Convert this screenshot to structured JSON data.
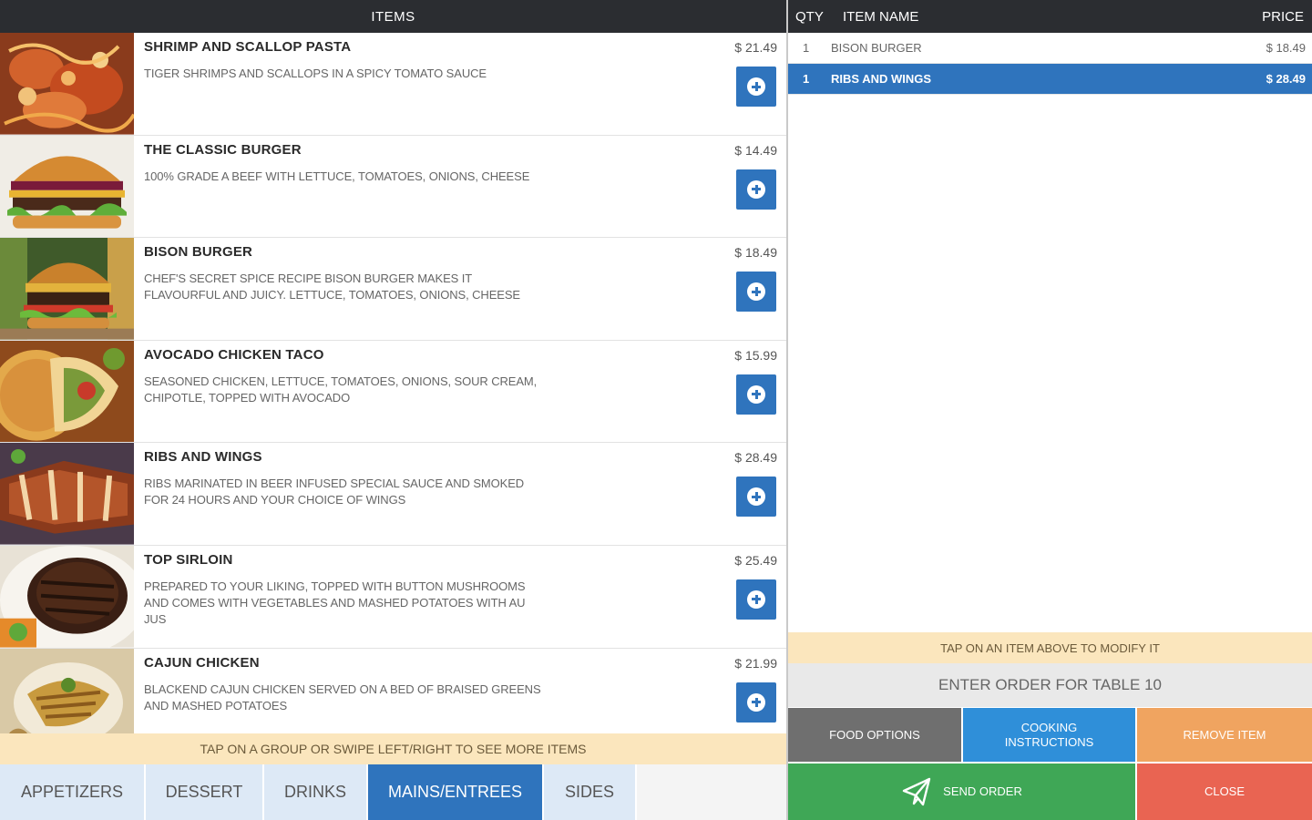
{
  "left_header": {
    "title": "ITEMS"
  },
  "menu_items": [
    {
      "name": "SHRIMP AND SCALLOP PASTA",
      "description": "TIGER SHRIMPS AND SCALLOPS IN A SPICY TOMATO SAUCE",
      "price": "$ 21.49",
      "image": "pasta"
    },
    {
      "name": "THE CLASSIC BURGER",
      "description": "100% GRADE A BEEF WITH LETTUCE, TOMATOES, ONIONS, CHEESE",
      "price": "$ 14.49",
      "image": "burger"
    },
    {
      "name": "BISON BURGER",
      "description": "CHEF'S SECRET SPICE RECIPE BISON BURGER MAKES IT FLAVOURFUL AND JUICY. LETTUCE, TOMATOES, ONIONS, CHEESE",
      "price": "$ 18.49",
      "image": "bison-burger"
    },
    {
      "name": "AVOCADO CHICKEN TACO",
      "description": "SEASONED CHICKEN, LETTUCE, TOMATOES, ONIONS, SOUR CREAM, CHIPOTLE, TOPPED WITH AVOCADO",
      "price": "$ 15.99",
      "image": "taco"
    },
    {
      "name": "RIBS AND WINGS",
      "description": "RIBS MARINATED IN BEER INFUSED SPECIAL SAUCE AND SMOKED FOR 24 HOURS AND YOUR CHOICE OF WINGS",
      "price": "$ 28.49",
      "image": "ribs"
    },
    {
      "name": "TOP SIRLOIN",
      "description": "PREPARED TO YOUR LIKING, TOPPED WITH BUTTON MUSHROOMS AND COMES WITH VEGETABLES AND MASHED POTATOES WITH AU JUS",
      "price": "$ 25.49",
      "image": "steak"
    },
    {
      "name": "CAJUN CHICKEN",
      "description": "BLACKEND CAJUN CHICKEN SERVED ON A BED OF BRAISED GREENS AND MASHED POTATOES",
      "price": "$ 21.99",
      "image": "cajun-chicken"
    }
  ],
  "left_hint": "TAP ON A GROUP OR SWIPE LEFT/RIGHT TO SEE MORE ITEMS",
  "tabs": [
    {
      "label": "APPETIZERS",
      "active": false
    },
    {
      "label": "DESSERT",
      "active": false
    },
    {
      "label": "DRINKS",
      "active": false
    },
    {
      "label": "MAINS/ENTREES",
      "active": true
    },
    {
      "label": "SIDES",
      "active": false
    }
  ],
  "order_header": {
    "qty": "QTY",
    "item_name": "ITEM NAME",
    "price": "PRICE"
  },
  "order_items": [
    {
      "qty": "1",
      "name": "BISON BURGER",
      "price": "$ 18.49",
      "selected": false
    },
    {
      "qty": "1",
      "name": "RIBS AND WINGS",
      "price": "$ 28.49",
      "selected": true
    }
  ],
  "right_hint": "TAP ON AN ITEM ABOVE TO MODIFY IT",
  "order_input": {
    "placeholder": "ENTER ORDER FOR TABLE 10"
  },
  "actions": {
    "food_options": "FOOD OPTIONS",
    "cooking_line1": "COOKING",
    "cooking_line2": "INSTRUCTIONS",
    "remove_item": "REMOVE ITEM",
    "send_order": "SEND ORDER",
    "close": "CLOSE"
  },
  "colors": {
    "header_bg": "#2b2d31",
    "accent_blue": "#2f74bd",
    "hint_bg": "#fbe6bd",
    "food_options": "#6f6f6f",
    "cooking": "#2f8fd9",
    "remove": "#f0a460",
    "send": "#3fa756",
    "close": "#e96452"
  }
}
